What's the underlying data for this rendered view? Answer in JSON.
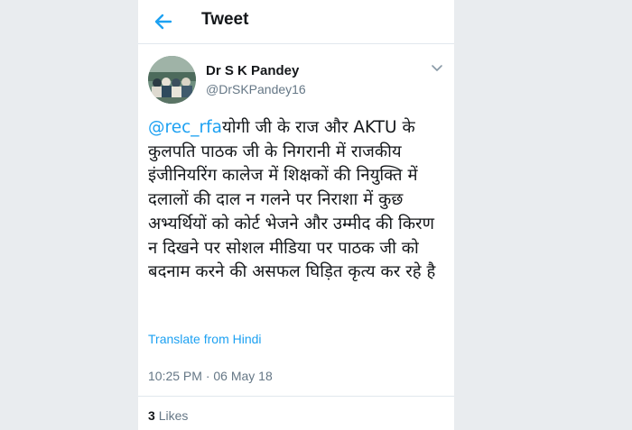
{
  "header": {
    "title": "Tweet",
    "back_icon": "back-arrow-icon",
    "accent_color": "#1da1f2"
  },
  "author": {
    "name": "Dr S K Pandey",
    "handle": "@DrSKPandey16",
    "avatar_icon": "avatar-photo"
  },
  "tweet": {
    "mention": "@rec_rfa",
    "body": "योगी जी के राज और AKTU के कुलपति पाठक जी के निगरानी में राजकीय इंजीनियरिंग कालेज में शिक्षकों की नियुक्ति में दलालों की दाल न गलने पर निराशा में कुछ अभ्यर्थियों को कोर्ट भेजने और उम्मीद की किरण न दिखने पर सोशल मीडिया पर पाठक जी को बदनाम करने की असफल घिड़ित कृत्य कर रहे है",
    "translate_label": "Translate from Hindi",
    "timestamp": "10:25 PM · 06 May 18",
    "menu_icon": "chevron-down-icon"
  },
  "stats": {
    "likes_count": "3",
    "likes_label": "Likes"
  }
}
